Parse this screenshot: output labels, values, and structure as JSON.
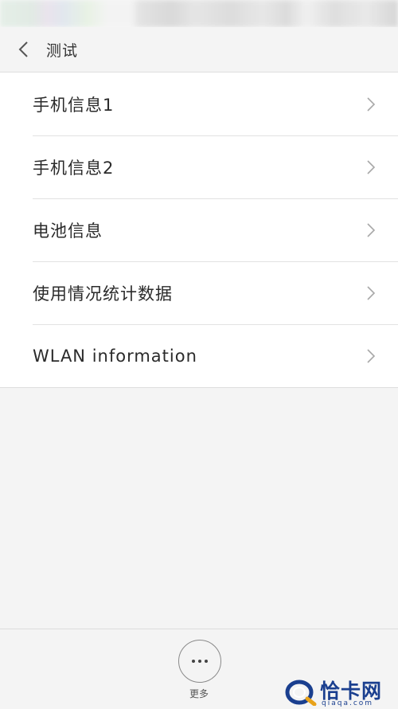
{
  "header": {
    "title": "测试"
  },
  "list": {
    "items": [
      {
        "label": "手机信息1"
      },
      {
        "label": "手机信息2"
      },
      {
        "label": "电池信息"
      },
      {
        "label": "使用情况统计数据"
      },
      {
        "label": "WLAN information"
      }
    ]
  },
  "bottom_bar": {
    "more_label": "更多"
  },
  "watermark": {
    "name": "恰卡网",
    "url": "qiaqa.com"
  },
  "colors": {
    "background": "#f4f4f4",
    "list_background": "#ffffff",
    "text": "#2b2b2b",
    "watermark": "#1a3f8f"
  },
  "icons": {
    "back": "chevron-left-icon",
    "item_arrow": "chevron-right-icon",
    "more": "more-dots-icon"
  }
}
